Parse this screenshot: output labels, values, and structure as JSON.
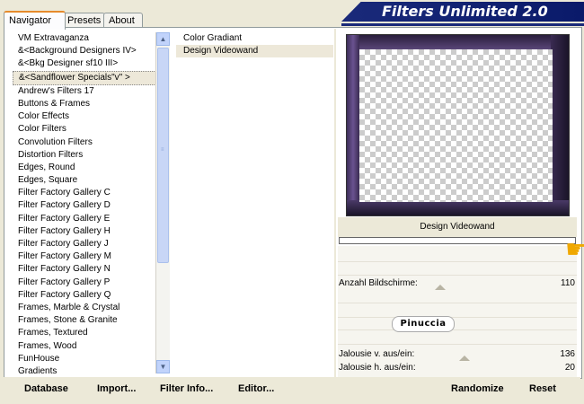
{
  "header": {
    "title": "Filters Unlimited 2.0"
  },
  "tabs": [
    {
      "label": "Navigator"
    },
    {
      "label": "Presets"
    },
    {
      "label": "About"
    }
  ],
  "categories": [
    "VM Extravaganza",
    "&<Background Designers IV>",
    "&<Bkg Designer sf10 III>",
    "&<Sandflower Specials\"v\" >",
    "Andrew's Filters 17",
    "Buttons & Frames",
    "Color Effects",
    "Color Filters",
    "Convolution Filters",
    "Distortion Filters",
    "Edges, Round",
    "Edges, Square",
    "Filter Factory Gallery C",
    "Filter Factory Gallery D",
    "Filter Factory Gallery E",
    "Filter Factory Gallery H",
    "Filter Factory Gallery J",
    "Filter Factory Gallery M",
    "Filter Factory Gallery N",
    "Filter Factory Gallery P",
    "Filter Factory Gallery Q",
    "Frames, Marble & Crystal",
    "Frames, Stone & Granite",
    "Frames, Textured",
    "Frames, Wood",
    "FunHouse",
    "Gradients"
  ],
  "selected_category_index": 3,
  "filters": [
    "Color Gradiant",
    "Design Videowand"
  ],
  "selected_filter_index": 1,
  "preview": {
    "filter_name": "Design Videowand"
  },
  "params": [
    {
      "label": "Anzahl Bildschirme:",
      "value": "110"
    },
    {
      "label": "Jalousie v. aus/ein:",
      "value": "136"
    },
    {
      "label": "Jalousie h. aus/ein:",
      "value": "20"
    }
  ],
  "logo_text": "Pinuccia",
  "buttons": {
    "database": "Database",
    "import": "Import...",
    "filter_info": "Filter Info...",
    "editor": "Editor...",
    "randomize": "Randomize",
    "reset": "Reset"
  },
  "colors": {
    "banner": "#1a2a7a",
    "selection": "#ede8d9",
    "accent_tab": "#e68b2c"
  }
}
